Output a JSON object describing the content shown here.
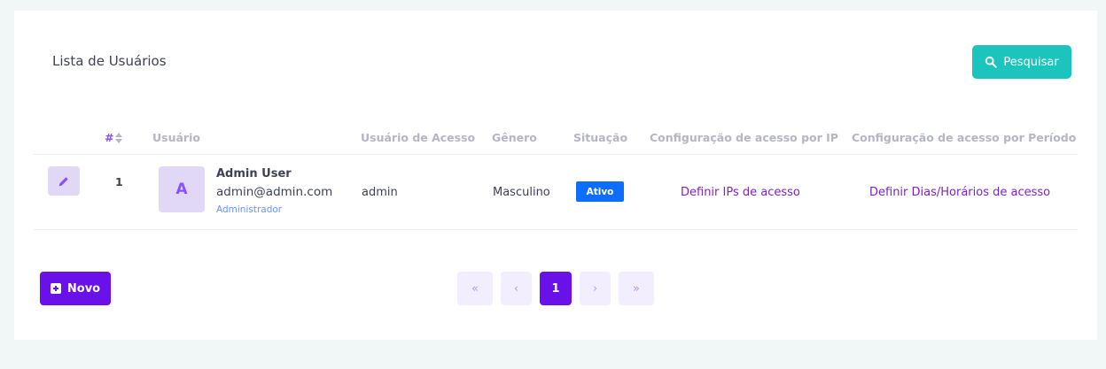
{
  "header": {
    "title": "Lista de Usuários",
    "search_label": "Pesquisar"
  },
  "table": {
    "columns": [
      "#",
      "Usuário",
      "Usuário de Acesso",
      "Gênero",
      "Situação",
      "Configuração de acesso por IP",
      "Configuração de acesso por Período"
    ],
    "rows": [
      {
        "id": "1",
        "avatar_letter": "A",
        "name": "Admin User",
        "email": "admin@admin.com",
        "role": "Administrador",
        "login": "admin",
        "gender": "Masculino",
        "status": "Ativo",
        "ip_link": "Definir IPs de acesso",
        "period_link": "Definir Dias/Horários de acesso"
      }
    ]
  },
  "footer": {
    "new_label": "Novo",
    "pagination": {
      "first": "«",
      "prev": "‹",
      "current": "1",
      "next": "›",
      "last": "»"
    }
  },
  "icons": [
    "search-icon",
    "sort-icon",
    "pencil-icon",
    "plus-square-icon"
  ],
  "colors": {
    "accent": "#6a11e9",
    "search": "#1bc5bd",
    "status": "#0d6efd",
    "link": "#7e22ce"
  }
}
